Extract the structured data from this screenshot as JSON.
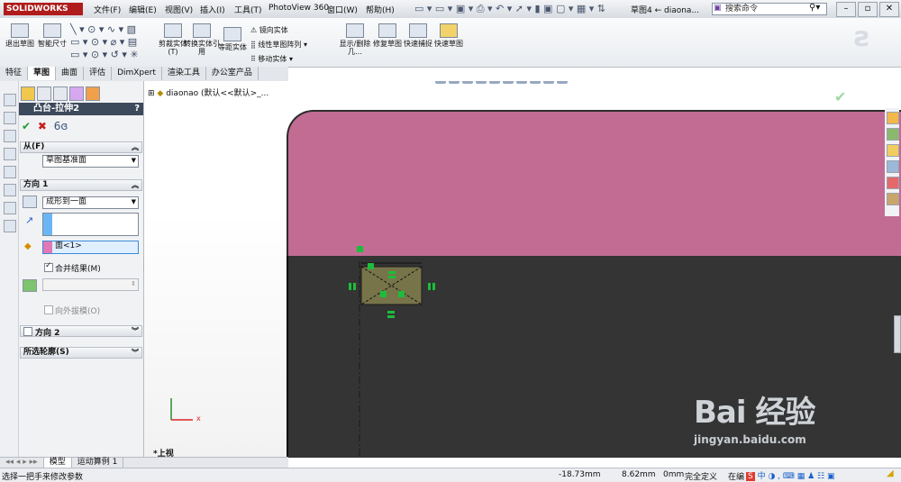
{
  "app": {
    "logo": "SOLIDWORKS",
    "document": "草图4 ← diaona..."
  },
  "menu": [
    {
      "label": "文件(F)"
    },
    {
      "label": "编辑(E)"
    },
    {
      "label": "视图(V)"
    },
    {
      "label": "插入(I)"
    },
    {
      "label": "工具(T)"
    },
    {
      "label": "PhotoView 360"
    },
    {
      "label": "窗口(W)"
    },
    {
      "label": "帮助(H)"
    }
  ],
  "search": {
    "placeholder": "搜索命令"
  },
  "commands": [
    {
      "label": "退出草图"
    },
    {
      "label": "智能尺寸"
    },
    {
      "label": "剪裁实体(T)"
    },
    {
      "label": "转换实体引用"
    },
    {
      "label": "等距实体"
    },
    {
      "label": "显示/删除几…"
    },
    {
      "label": "修复草图"
    },
    {
      "label": "快速捕捉"
    },
    {
      "label": "快速草图"
    }
  ],
  "small_commands": {
    "mirror": "镜向实体",
    "linear_pattern": "线性草图阵列",
    "move": "移动实体"
  },
  "tabs": [
    {
      "label": "特征"
    },
    {
      "label": "草图",
      "active": true
    },
    {
      "label": "曲面"
    },
    {
      "label": "评估"
    },
    {
      "label": "DimXpert"
    },
    {
      "label": "渲染工具"
    },
    {
      "label": "办公室产品"
    }
  ],
  "property_manager": {
    "title": "凸台-拉伸2",
    "help": "?",
    "from": {
      "header": "从(F)",
      "value": "草图基准面"
    },
    "direction1": {
      "header": "方向 1",
      "end_condition": "成形到一面",
      "face": "面<1>",
      "merge_result_label": "合并结果(M)",
      "merge_result_checked": true,
      "draft_outward_label": "向外拔模(O)"
    },
    "direction2": {
      "header": "方向 2"
    },
    "selected_contours": {
      "header": "所选轮廓(S)"
    }
  },
  "tree": {
    "label": "diaonao  (默认<<默认>_..."
  },
  "view": {
    "name": "*上视",
    "axis_x": "x"
  },
  "bottom_tabs": [
    {
      "label": "模型",
      "active": true
    },
    {
      "label": "运动算例 1"
    }
  ],
  "status": {
    "message": "选择一把手来修改参数",
    "x": "-18.73mm",
    "y": "8.62mm",
    "z": "0mm",
    "state": "完全定义",
    "editing": "在编"
  },
  "watermark": {
    "line1": "Bai 经验",
    "line2": "jingyan.baidu.com"
  },
  "colors": {
    "part_top": "#c26c94",
    "part_body": "#343434",
    "sketch_fill": "#77744a",
    "relation_green": "#1cbd3a"
  }
}
